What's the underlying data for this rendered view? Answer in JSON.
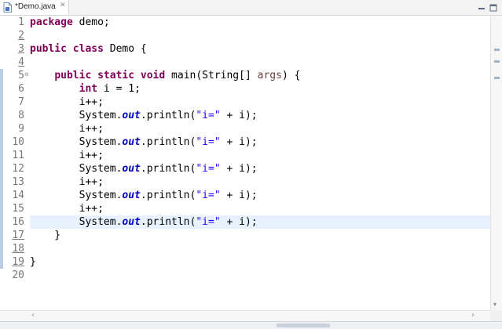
{
  "tab": {
    "title": "*Demo.java",
    "close_glyph": "✕",
    "file_icon": "java-file-icon"
  },
  "window_controls": {
    "minimize_icon": "minimize-icon",
    "maximize_icon": "maximize-icon"
  },
  "editor": {
    "current_line": 16,
    "colors": {
      "keyword": "#7f0055",
      "string": "#2a00ff",
      "static_field": "#0000c0",
      "parameter": "#6a3e3e",
      "current_line_bg": "#e8f2fe",
      "change_marker": "#b9cde4"
    },
    "line_numbers": [
      "1",
      "2",
      "3",
      "4",
      "5",
      "6",
      "7",
      "8",
      "9",
      "10",
      "11",
      "12",
      "13",
      "14",
      "15",
      "16",
      "17",
      "18",
      "19",
      "20"
    ],
    "lines": [
      [
        {
          "t": "package",
          "c": "kw"
        },
        {
          "t": " demo;",
          "c": ""
        }
      ],
      [],
      [
        {
          "t": "public",
          "c": "kw"
        },
        {
          "t": " ",
          "c": ""
        },
        {
          "t": "class",
          "c": "kw"
        },
        {
          "t": " Demo {",
          "c": ""
        }
      ],
      [],
      [
        {
          "t": "    ",
          "c": ""
        },
        {
          "t": "public",
          "c": "kw"
        },
        {
          "t": " ",
          "c": ""
        },
        {
          "t": "static",
          "c": "kw"
        },
        {
          "t": " ",
          "c": ""
        },
        {
          "t": "void",
          "c": "kw"
        },
        {
          "t": " main(String[] ",
          "c": ""
        },
        {
          "t": "args",
          "c": "param"
        },
        {
          "t": ") {",
          "c": ""
        }
      ],
      [
        {
          "t": "        ",
          "c": ""
        },
        {
          "t": "int",
          "c": "kw"
        },
        {
          "t": " i = 1;",
          "c": ""
        }
      ],
      [
        {
          "t": "        i++;",
          "c": ""
        }
      ],
      [
        {
          "t": "        System.",
          "c": ""
        },
        {
          "t": "out",
          "c": "fld"
        },
        {
          "t": ".println(",
          "c": ""
        },
        {
          "t": "\"i=\"",
          "c": "str"
        },
        {
          "t": " + i);",
          "c": ""
        }
      ],
      [
        {
          "t": "        i++;",
          "c": ""
        }
      ],
      [
        {
          "t": "        System.",
          "c": ""
        },
        {
          "t": "out",
          "c": "fld"
        },
        {
          "t": ".println(",
          "c": ""
        },
        {
          "t": "\"i=\"",
          "c": "str"
        },
        {
          "t": " + i);",
          "c": ""
        }
      ],
      [
        {
          "t": "        i++;",
          "c": ""
        }
      ],
      [
        {
          "t": "        System.",
          "c": ""
        },
        {
          "t": "out",
          "c": "fld"
        },
        {
          "t": ".println(",
          "c": ""
        },
        {
          "t": "\"i=\"",
          "c": "str"
        },
        {
          "t": " + i);",
          "c": ""
        }
      ],
      [
        {
          "t": "        i++;",
          "c": ""
        }
      ],
      [
        {
          "t": "        System.",
          "c": ""
        },
        {
          "t": "out",
          "c": "fld"
        },
        {
          "t": ".println(",
          "c": ""
        },
        {
          "t": "\"i=\"",
          "c": "str"
        },
        {
          "t": " + i);",
          "c": ""
        }
      ],
      [
        {
          "t": "        i++;",
          "c": ""
        }
      ],
      [
        {
          "t": "        System.",
          "c": ""
        },
        {
          "t": "out",
          "c": "fld"
        },
        {
          "t": ".println(",
          "c": ""
        },
        {
          "t": "\"i=\"",
          "c": "str"
        },
        {
          "t": " + i);",
          "c": ""
        }
      ],
      [
        {
          "t": "    }",
          "c": ""
        }
      ],
      [],
      [
        {
          "t": "}",
          "c": ""
        }
      ],
      []
    ],
    "changed_lines": [
      2,
      3,
      4,
      17,
      18,
      19
    ],
    "fold_glyph": "⊖"
  },
  "scroll": {
    "left_arrow": "‹",
    "right_arrow": "›",
    "down_arrow": "▾"
  }
}
